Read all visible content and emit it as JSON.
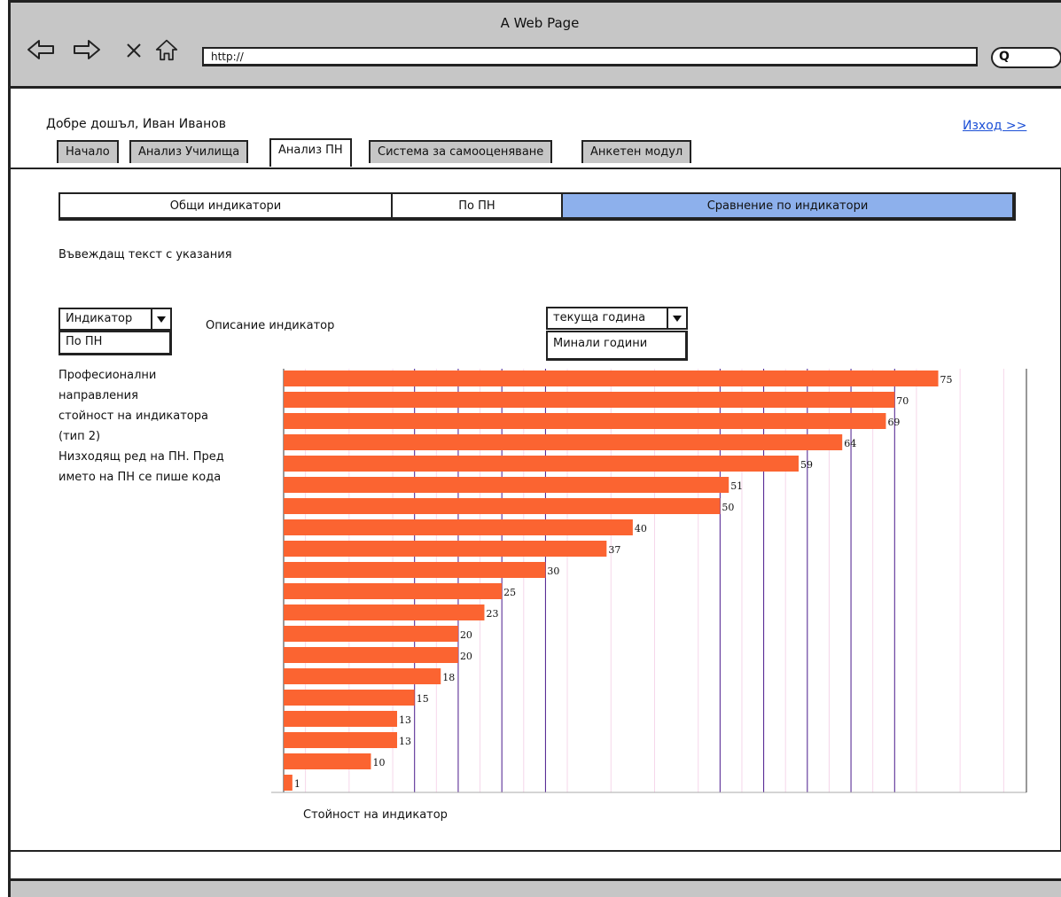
{
  "window": {
    "title": "A Web Page",
    "url": "http://",
    "search_glyph": "Q"
  },
  "header": {
    "welcome": "Добре дошъл, Иван Иванов",
    "logout": "Изход >>"
  },
  "tabs": [
    {
      "label": "Начало",
      "active": false
    },
    {
      "label": "Анализ Училища",
      "active": false
    },
    {
      "label": "Анализ ПН",
      "active": true
    },
    {
      "label": "Система за самооценяване",
      "active": false
    },
    {
      "label": "Анкетен модул",
      "active": false
    }
  ],
  "subtabs": [
    {
      "label": "Общи индикатори",
      "selected": false
    },
    {
      "label": "По ПН",
      "selected": false
    },
    {
      "label": "Сравнение по индикатори",
      "selected": true
    }
  ],
  "intro_text": "Въвеждащ текст с указания",
  "indicator_select": {
    "value": "Индикатор",
    "option": "По ПН"
  },
  "indicator_description": "Описание индикатор",
  "year_select": {
    "value": "текуща година",
    "option": "Минали години"
  },
  "notes": [
    "Професионални",
    "направления",
    "стойност на индикатора",
    "(тип 2)",
    "Низходящ ред  на ПН. Пред",
    "името на ПН се пише кода"
  ],
  "colors": {
    "chrome": "#c6c6c6",
    "selected_subtab": "#8db0ec",
    "bar": "#fb6431",
    "major_grid": "#4a1a8c",
    "minor_grid": "#f6d7ea",
    "link": "#1b4fd6"
  },
  "chart_data": {
    "type": "bar",
    "orientation": "horizontal",
    "values": [
      75,
      70,
      69,
      64,
      59,
      51,
      50,
      40,
      37,
      30,
      25,
      23,
      20,
      20,
      18,
      15,
      13,
      13,
      10,
      1
    ],
    "xlabel": "Стойност на индикатор",
    "xlim": [
      0,
      85
    ],
    "grid": true
  }
}
